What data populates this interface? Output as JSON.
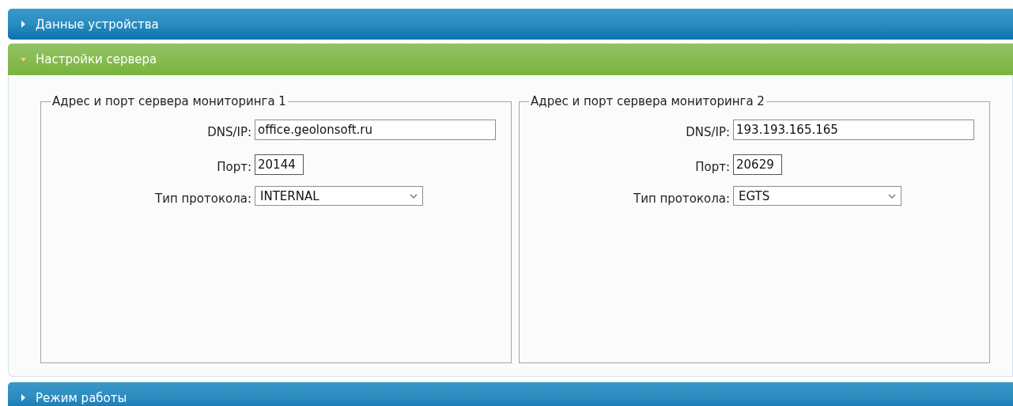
{
  "sections": [
    {
      "title": "Данные устройства",
      "expanded": false
    },
    {
      "title": "Настройки сервера",
      "expanded": true,
      "servers": [
        {
          "legend": "Адрес и порт сервера мониторинга 1",
          "fields": [
            {
              "kind": "text",
              "label": "DNS/IP:",
              "value": "office.geolonsoft.ru"
            },
            {
              "kind": "port",
              "label": "Порт:",
              "value": "20144"
            },
            {
              "kind": "select",
              "label": "Тип протокола:",
              "value": "INTERNAL"
            }
          ]
        },
        {
          "legend": "Адрес и порт сервера мониторинга 2",
          "fields": [
            {
              "kind": "text",
              "label": "DNS/IP:",
              "value": "193.193.165.165"
            },
            {
              "kind": "port",
              "label": "Порт:",
              "value": "20629"
            },
            {
              "kind": "select",
              "label": "Тип протокола:",
              "value": "EGTS"
            }
          ]
        }
      ]
    },
    {
      "title": "Режим работы",
      "expanded": false
    }
  ]
}
